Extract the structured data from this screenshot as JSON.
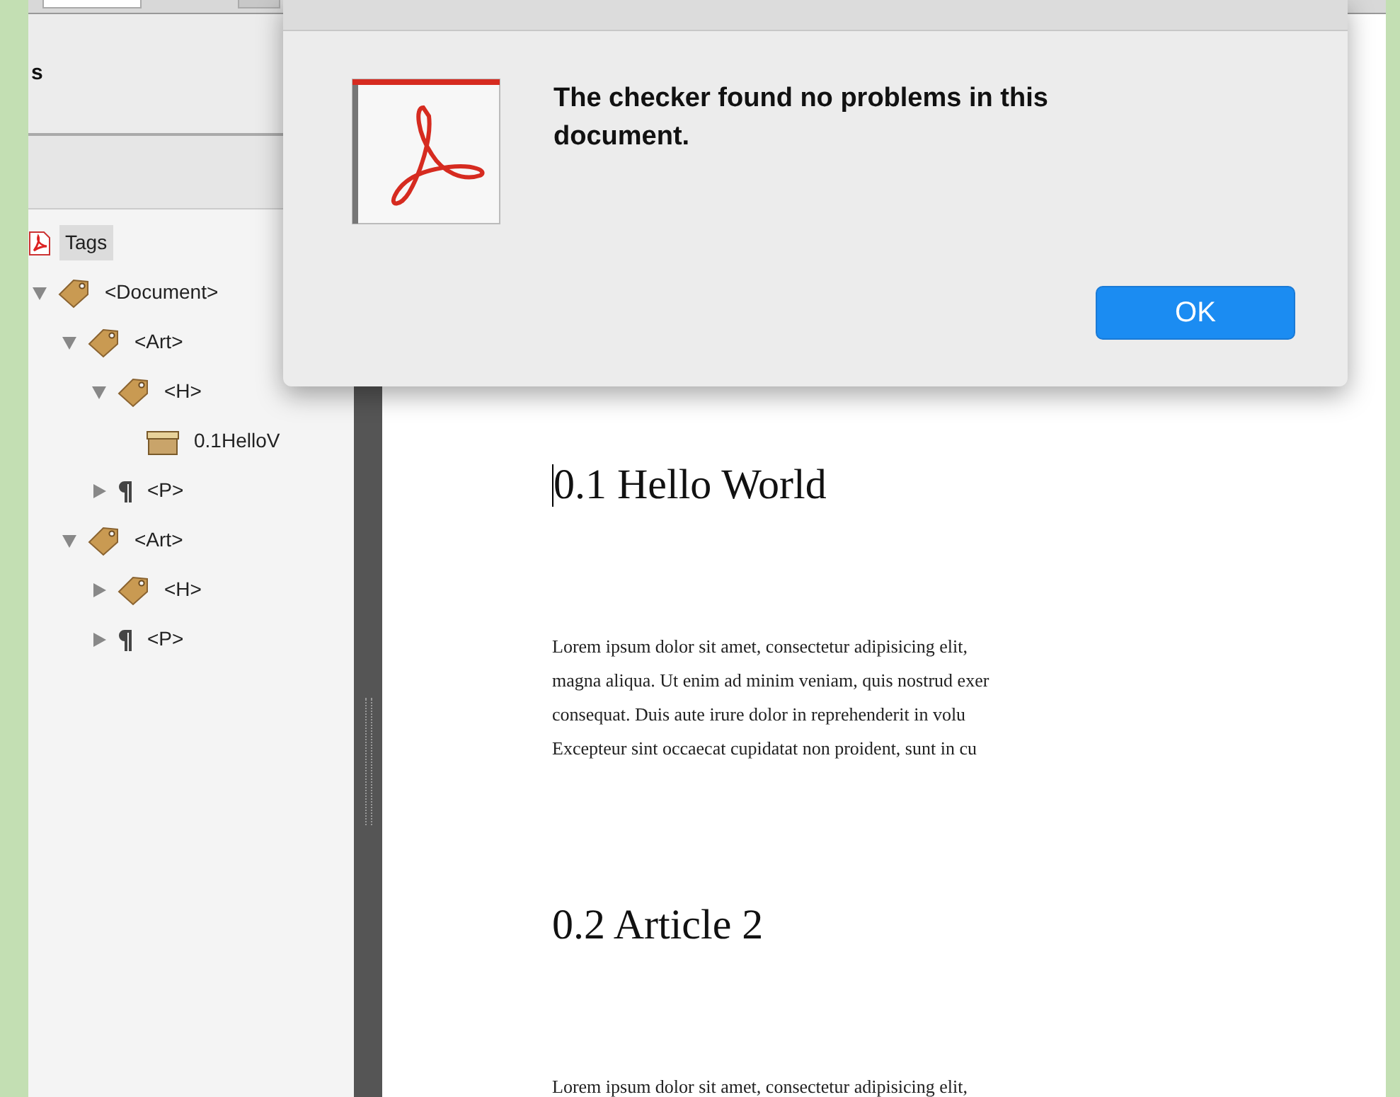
{
  "sidebar": {
    "panel_title": "s",
    "tree": [
      {
        "label": "Tags",
        "kind": "root",
        "selected": true,
        "children": [
          {
            "label": "<Document>",
            "kind": "tag",
            "selected": false,
            "expanded": true,
            "children": [
              {
                "label": "<Art>",
                "kind": "tag",
                "selected": false,
                "expanded": true,
                "children": [
                  {
                    "label": "<H>",
                    "kind": "tag",
                    "selected": false,
                    "expanded": true,
                    "children": [
                      {
                        "label": "0.1HelloV",
                        "kind": "content",
                        "selected": false
                      }
                    ]
                  },
                  {
                    "label": "<P>",
                    "kind": "paragraph",
                    "selected": false,
                    "expanded": false
                  }
                ]
              },
              {
                "label": "<Art>",
                "kind": "tag",
                "selected": false,
                "expanded": true,
                "children": [
                  {
                    "label": "<H>",
                    "kind": "tag",
                    "selected": false,
                    "expanded": false
                  },
                  {
                    "label": "<P>",
                    "kind": "paragraph",
                    "selected": false,
                    "expanded": false
                  }
                ]
              }
            ]
          }
        ]
      }
    ]
  },
  "document": {
    "blocks": [
      {
        "kind": "heading",
        "text": "0.1 Hello World",
        "cursor": true
      },
      {
        "kind": "paragraph",
        "lines": [
          "Lorem ipsum dolor sit amet, consectetur adipisicing elit,",
          "magna aliqua. Ut enim ad minim veniam, quis nostrud exer",
          "consequat. Duis aute irure dolor in reprehenderit in volu",
          "Excepteur sint occaecat cupidatat non proident, sunt in cu"
        ]
      },
      {
        "kind": "heading",
        "text": "0.2 Article 2",
        "cursor": false
      },
      {
        "kind": "paragraph",
        "lines": [
          "Lorem ipsum dolor sit amet, consectetur adipisicing elit,"
        ]
      }
    ]
  },
  "dialog": {
    "message": "The checker found no problems in this document.",
    "buttons": [
      "OK"
    ]
  }
}
